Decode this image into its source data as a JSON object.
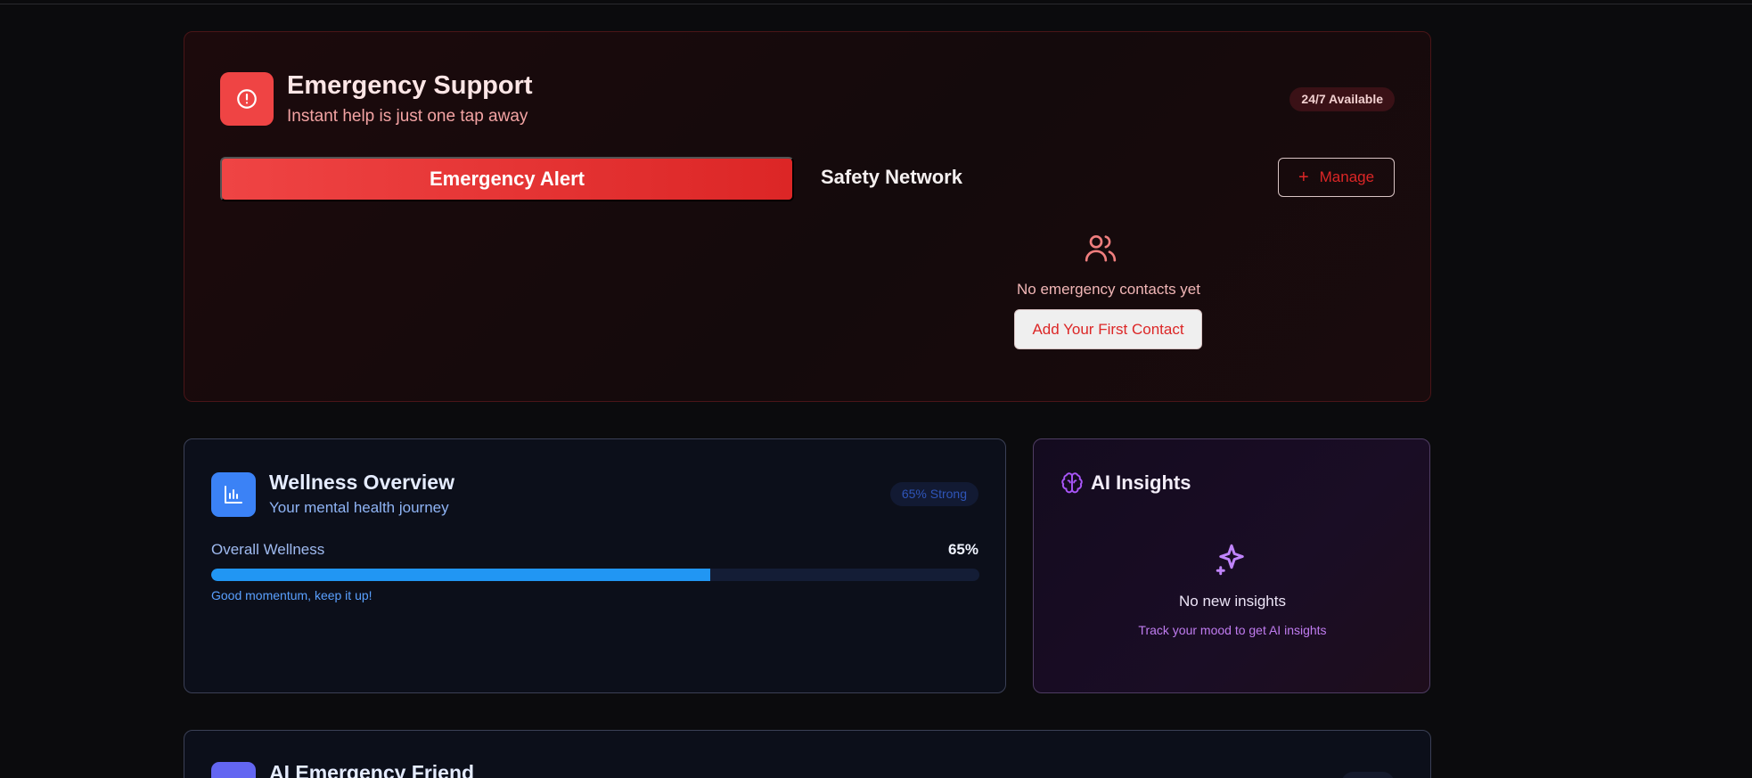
{
  "emergency": {
    "title": "Emergency Support",
    "subtitle": "Instant help is just one tap away",
    "availability_badge": "24/7 Available",
    "alert_button": "Emergency Alert",
    "safety_network_title": "Safety Network",
    "manage_button": "Manage",
    "empty_contacts": "No emergency contacts yet",
    "add_contact_button": "Add Your First Contact"
  },
  "wellness": {
    "title": "Wellness Overview",
    "subtitle": "Your mental health journey",
    "badge": "65% Strong",
    "metric_label": "Overall Wellness",
    "metric_value": "65%",
    "progress_fraction": 0.65,
    "note": "Good momentum, keep it up!"
  },
  "insights": {
    "title": "AI Insights",
    "empty_title": "No new insights",
    "empty_hint": "Track your mood to get AI insights"
  },
  "friend": {
    "title": "AI Emergency Friend"
  },
  "icons": {
    "emergency": "alert-circle-icon",
    "contacts": "users-icon",
    "wellness": "bar-chart-icon",
    "insights": "brain-icon",
    "empty_insights": "sparkles-icon",
    "manage": "plus-icon"
  },
  "colors": {
    "emergency_accent": "#ef4444",
    "wellness_accent": "#3b82f6",
    "progress_fill": "#2196f3",
    "insights_accent": "#a855f7"
  }
}
